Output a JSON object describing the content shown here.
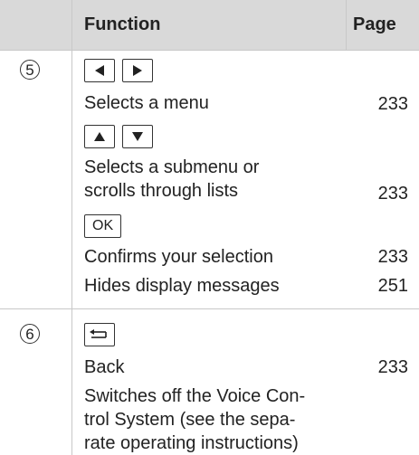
{
  "header": {
    "function": "Function",
    "page": "Page"
  },
  "sections": [
    {
      "number": "5",
      "keys_1": [
        "left-arrow",
        "right-arrow"
      ],
      "item_1": {
        "text": "Selects a menu",
        "page": "233"
      },
      "keys_2": [
        "up-arrow",
        "down-arrow"
      ],
      "item_2": {
        "text_line1": "Selects a submenu or",
        "text_line2": "scrolls through lists",
        "page": "233"
      },
      "key_ok": "OK",
      "item_3": {
        "text": "Confirms your selection",
        "page": "233"
      },
      "item_4": {
        "text": "Hides display messages",
        "page": "251"
      }
    },
    {
      "number": "6",
      "key_back": "back-icon",
      "item_1": {
        "text": "Back",
        "page": "233"
      },
      "item_2": {
        "text_line1": "Switches off the Voice Con-",
        "text_line2": "trol System (see the sepa-",
        "text_line3": "rate operating instructions)"
      }
    }
  ]
}
